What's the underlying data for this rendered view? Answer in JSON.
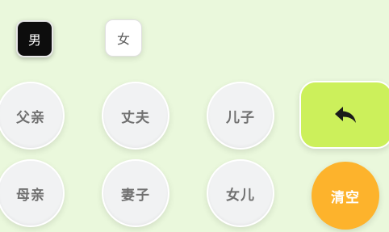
{
  "gender": {
    "male_label": "男",
    "female_label": "女",
    "selected": "male"
  },
  "keys": {
    "father": "父亲",
    "husband": "丈夫",
    "son": "儿子",
    "mother": "母亲",
    "wife": "妻子",
    "daughter": "女儿"
  },
  "actions": {
    "back_icon": "undo-arrow-icon",
    "clear_label": "清空"
  },
  "colors": {
    "background": "#eaf8dc",
    "selected_gender": "#0d0d0d",
    "back_button": "#ccf05b",
    "clear_button": "#fdb32c"
  }
}
